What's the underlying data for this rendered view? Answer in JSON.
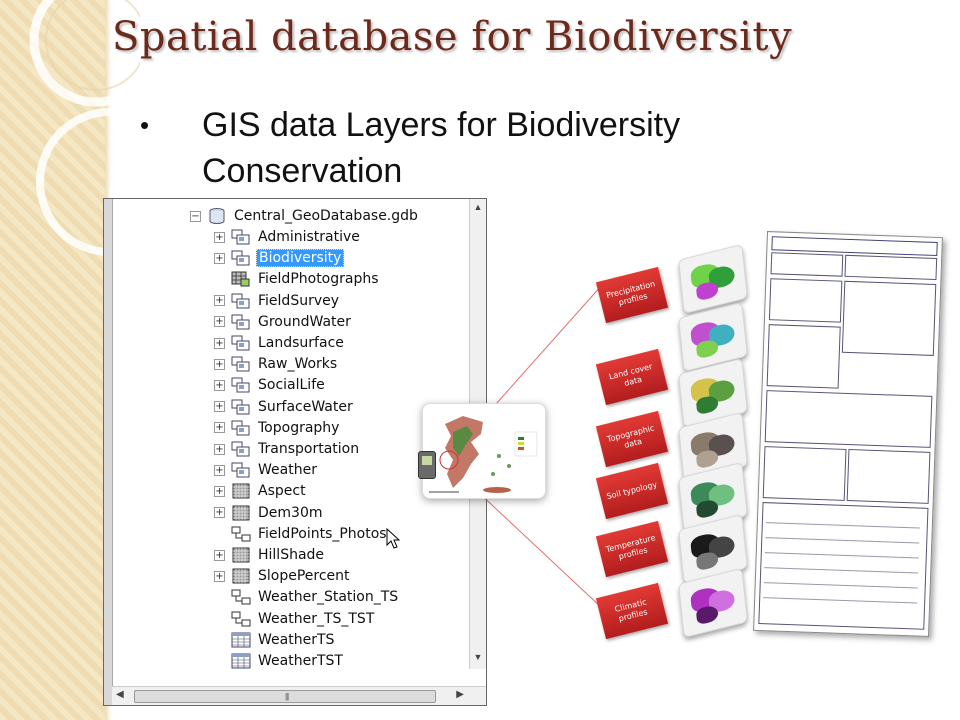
{
  "slide": {
    "title": "Spatial database for Biodiversity",
    "bullet_mark": "•",
    "bullet_text": "GIS data Layers for Biodiversity Conservation"
  },
  "catalog": {
    "root": "Central_GeoDatabase.gdb",
    "items": [
      {
        "label": "Administrative",
        "icon": "feature-dataset-icon",
        "expandable": true
      },
      {
        "label": "Biodiversity",
        "icon": "feature-dataset-icon",
        "expandable": true,
        "selected": true
      },
      {
        "label": "FieldPhotographs",
        "icon": "raster-catalog-icon",
        "expandable": false
      },
      {
        "label": "FieldSurvey",
        "icon": "feature-dataset-icon",
        "expandable": true
      },
      {
        "label": "GroundWater",
        "icon": "feature-dataset-icon",
        "expandable": true
      },
      {
        "label": "Landsurface",
        "icon": "feature-dataset-icon",
        "expandable": true
      },
      {
        "label": "Raw_Works",
        "icon": "feature-dataset-icon",
        "expandable": true
      },
      {
        "label": "SocialLife",
        "icon": "feature-dataset-icon",
        "expandable": true
      },
      {
        "label": "SurfaceWater",
        "icon": "feature-dataset-icon",
        "expandable": true
      },
      {
        "label": "Topography",
        "icon": "feature-dataset-icon",
        "expandable": true
      },
      {
        "label": "Transportation",
        "icon": "feature-dataset-icon",
        "expandable": true
      },
      {
        "label": "Weather",
        "icon": "feature-dataset-icon",
        "expandable": true
      },
      {
        "label": "Aspect",
        "icon": "raster-dataset-icon",
        "expandable": true
      },
      {
        "label": "Dem30m",
        "icon": "raster-dataset-icon",
        "expandable": true
      },
      {
        "label": "FieldPoints_Photos",
        "icon": "relationship-class-icon",
        "expandable": false
      },
      {
        "label": "HillShade",
        "icon": "raster-dataset-icon",
        "expandable": true
      },
      {
        "label": "SlopePercent",
        "icon": "raster-dataset-icon",
        "expandable": true
      },
      {
        "label": "Weather_Station_TS",
        "icon": "relationship-class-icon",
        "expandable": false
      },
      {
        "label": "Weather_TS_TST",
        "icon": "relationship-class-icon",
        "expandable": false
      },
      {
        "label": "WeatherTS",
        "icon": "table-icon",
        "expandable": false
      },
      {
        "label": "WeatherTST",
        "icon": "table-icon",
        "expandable": false
      }
    ]
  },
  "layers": [
    {
      "label": "Precipitation profiles",
      "colors": [
        "#6fd34a",
        "#2f9f3a",
        "#c040d0"
      ]
    },
    {
      "label": "Land cover data",
      "colors": [
        "#c050d0",
        "#40b0c0",
        "#7fcf50"
      ]
    },
    {
      "label": "Topographic data",
      "colors": [
        "#d4c24a",
        "#5aa040",
        "#2e7d32"
      ]
    },
    {
      "label": "Soil typology",
      "colors": [
        "#8a7a6a",
        "#5a5050",
        "#b0a090"
      ]
    },
    {
      "label": "Temperature profiles",
      "colors": [
        "#3c8a5a",
        "#6fbf80",
        "#224a30"
      ]
    },
    {
      "label": "Climatic profiles",
      "colors": [
        "#1a1a1a",
        "#444444",
        "#777777"
      ]
    }
  ],
  "colors": {
    "title": "#6b2a1c",
    "selection": "#3399ff",
    "layer_label": "#d32f2f",
    "connector": "#e07070"
  }
}
